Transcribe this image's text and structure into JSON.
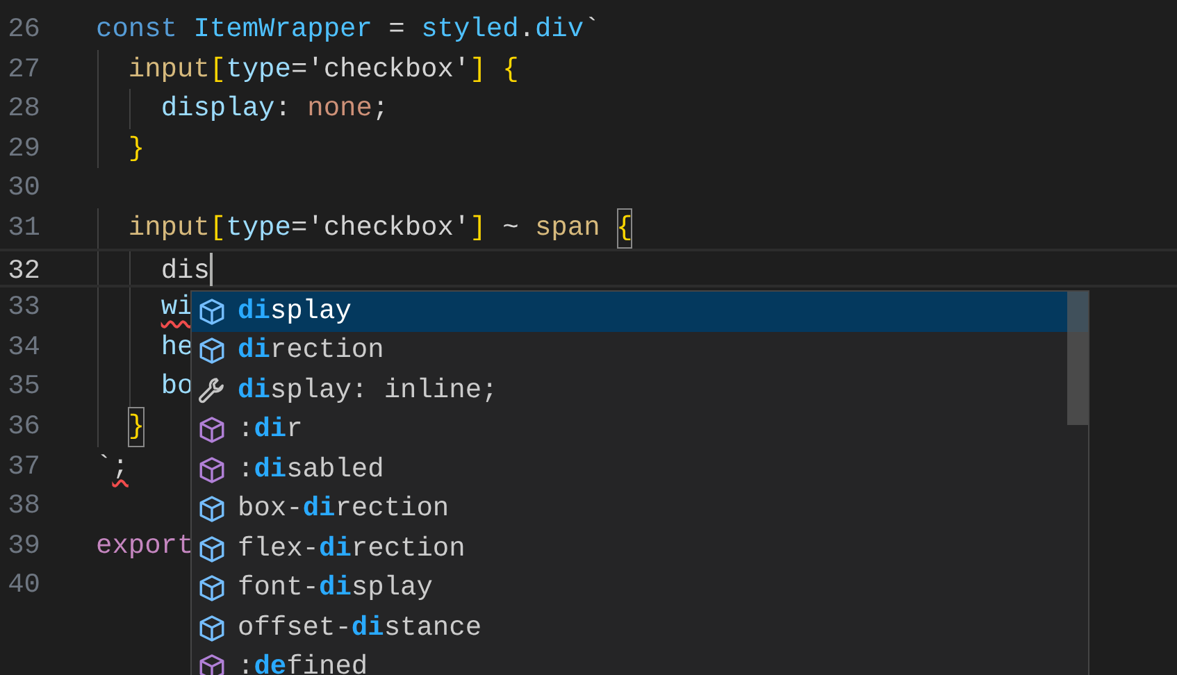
{
  "editor": {
    "lines": [
      {
        "number": "26",
        "current": false,
        "tokens": [
          {
            "kind": "keyword",
            "text": "const "
          },
          {
            "kind": "variable",
            "text": "ItemWrapper"
          },
          {
            "kind": "operator",
            "text": " = "
          },
          {
            "kind": "variable",
            "text": "styled"
          },
          {
            "kind": "operator",
            "text": "."
          },
          {
            "kind": "variable",
            "text": "div"
          },
          {
            "kind": "operator",
            "text": "`"
          }
        ]
      },
      {
        "number": "27",
        "current": false,
        "tokens": [
          {
            "kind": "selector",
            "text": "  input"
          },
          {
            "kind": "bracket",
            "text": "["
          },
          {
            "kind": "property",
            "text": "type"
          },
          {
            "kind": "operator",
            "text": "='checkbox'"
          },
          {
            "kind": "bracket",
            "text": "]"
          },
          {
            "kind": "bracket",
            "text": " {"
          }
        ]
      },
      {
        "number": "28",
        "current": false,
        "tokens": [
          {
            "kind": "property",
            "text": "    display"
          },
          {
            "kind": "operator",
            "text": ": "
          },
          {
            "kind": "value",
            "text": "none"
          },
          {
            "kind": "operator",
            "text": ";"
          }
        ]
      },
      {
        "number": "29",
        "current": false,
        "tokens": [
          {
            "kind": "bracket",
            "text": "  }"
          }
        ]
      },
      {
        "number": "30",
        "current": false
      },
      {
        "number": "31",
        "current": false,
        "tokens": [
          {
            "kind": "selector",
            "text": "  input"
          },
          {
            "kind": "bracket",
            "text": "["
          },
          {
            "kind": "property",
            "text": "type"
          },
          {
            "kind": "operator",
            "text": "='checkbox'"
          },
          {
            "kind": "bracket",
            "text": "]"
          },
          {
            "kind": "operator",
            "text": " ~ "
          },
          {
            "kind": "selector",
            "text": "span"
          },
          {
            "kind": "bracket",
            "text": " {",
            "matched": true
          }
        ]
      },
      {
        "number": "32",
        "current": true,
        "tokens": [
          {
            "kind": "operator",
            "text": "    dis"
          }
        ]
      },
      {
        "number": "33",
        "current": false,
        "tokens": [
          {
            "kind": "property",
            "text": "    wi",
            "error": true
          }
        ]
      },
      {
        "number": "34",
        "current": false,
        "tokens": [
          {
            "kind": "property",
            "text": "    he"
          }
        ]
      },
      {
        "number": "35",
        "current": false,
        "tokens": [
          {
            "kind": "property",
            "text": "    bo"
          }
        ]
      },
      {
        "number": "36",
        "current": false,
        "tokens": [
          {
            "kind": "bracket",
            "text": "  }",
            "matched": true
          }
        ]
      },
      {
        "number": "37",
        "current": false,
        "tokens": [
          {
            "kind": "operator",
            "text": "`"
          },
          {
            "kind": "operator",
            "text": ";",
            "error": true
          }
        ]
      },
      {
        "number": "38",
        "current": false
      },
      {
        "number": "39",
        "current": false,
        "tokens": [
          {
            "kind": "export",
            "text": "export"
          }
        ]
      },
      {
        "number": "40",
        "current": false
      }
    ]
  },
  "suggestions": [
    {
      "kind": "property",
      "match": "di",
      "after": "splay",
      "selected": true
    },
    {
      "kind": "property",
      "match": "di",
      "after": "rection",
      "selected": false
    },
    {
      "kind": "snippet",
      "match": "di",
      "after": "splay: inline;",
      "selected": false
    },
    {
      "kind": "pseudo",
      "before": ":",
      "match": "di",
      "after": "r",
      "selected": false
    },
    {
      "kind": "pseudo",
      "before": ":",
      "match": "di",
      "after": "sabled",
      "selected": false
    },
    {
      "kind": "property",
      "before": "box-",
      "match": "di",
      "after": "rection",
      "selected": false
    },
    {
      "kind": "property",
      "before": "flex-",
      "match": "di",
      "after": "rection",
      "selected": false
    },
    {
      "kind": "property",
      "before": "font-",
      "match": "di",
      "after": "splay",
      "selected": false
    },
    {
      "kind": "property",
      "before": "offset-",
      "match": "di",
      "after": "stance",
      "selected": false
    },
    {
      "kind": "pseudo",
      "before": ":",
      "match": "de",
      "after": "fined",
      "selected": false
    }
  ]
}
